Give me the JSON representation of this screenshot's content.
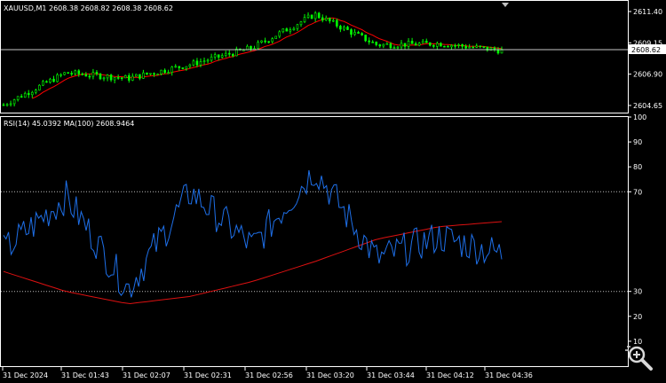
{
  "price_panel": {
    "symbol": "XAUUSD,M1",
    "ohlc": "2608.38 2608.82 2608.38 2608.62",
    "y_ticks": [
      "2611.40",
      "2609.15",
      "2606.90",
      "2604.65"
    ],
    "current_price": "2608.62",
    "candle_color": "#00ff00",
    "ma_color": "#ff0000"
  },
  "rsi_panel": {
    "header": "RSI(14) 45.0392 MA(100) 2608.9464",
    "y_ticks": [
      "100",
      "90",
      "80",
      "70",
      "30",
      "20",
      "10"
    ],
    "rsi_color": "#1e6fe8",
    "ma_color": "#dd1111"
  },
  "time_axis": [
    "31 Dec 2024",
    "31 Dec 01:43",
    "31 Dec 02:07",
    "31 Dec 02:31",
    "31 Dec 02:56",
    "31 Dec 03:20",
    "31 Dec 03:44",
    "31 Dec 04:12",
    "31 Dec 04:36"
  ],
  "zoom_icon": "magnifier-icon",
  "chart_data": [
    {
      "type": "line",
      "title": "XAUUSD,M1",
      "x": [
        "31 Dec 2024",
        "31 Dec 01:43",
        "31 Dec 02:07",
        "31 Dec 02:31",
        "31 Dec 02:56",
        "31 Dec 03:20",
        "31 Dec 03:44",
        "31 Dec 04:12",
        "31 Dec 04:36"
      ],
      "series": [
        {
          "name": "XAUUSD,M1",
          "values": [
            2604.7,
            2607.0,
            2606.6,
            2607.6,
            2608.8,
            2611.2,
            2609.0,
            2609.1,
            2608.6
          ]
        }
      ],
      "ylim": [
        2604.2,
        2612.1
      ]
    },
    {
      "type": "line",
      "title": "RSI(14) 45.0392 MA(100) 2608.9464",
      "x": [
        "31 Dec 2024",
        "31 Dec 01:43",
        "31 Dec 02:07",
        "31 Dec 02:31",
        "31 Dec 02:56",
        "31 Dec 03:20",
        "31 Dec 03:44",
        "31 Dec 04:12",
        "31 Dec 04:36"
      ],
      "series": [
        {
          "name": "RSI(14)",
          "values": [
            46,
            68,
            31,
            70,
            48,
            79,
            43,
            52,
            45
          ]
        },
        {
          "name": "MA(100)",
          "values": [
            38,
            30,
            25,
            28,
            34,
            42,
            51,
            56,
            58
          ]
        }
      ],
      "ylim": [
        0,
        100
      ]
    }
  ]
}
